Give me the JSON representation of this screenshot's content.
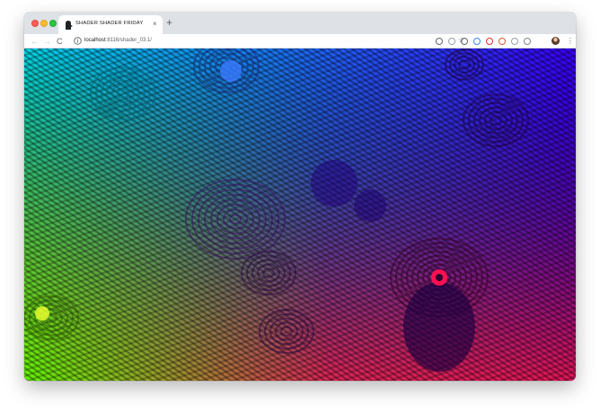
{
  "tab": {
    "title": "SHADER SHADER FRIDAY",
    "close_glyph": "×",
    "new_tab_glyph": "+"
  },
  "toolbar": {
    "back_glyph": "←",
    "forward_glyph": "→",
    "reload_glyph": "C",
    "url_host": "localhost",
    "url_rest": ":8116/shader_03.1/",
    "bookmark_glyph": "☆",
    "menu_glyph": "⋮"
  },
  "extensions": [
    {
      "icon": "info-extension-icon",
      "color": "#5f6368"
    },
    {
      "icon": "page-extension-icon",
      "color": "#9aa0a6"
    },
    {
      "icon": "recycle-extension-icon",
      "color": "#5f6368"
    },
    {
      "icon": "chrome-extension-icon",
      "color": "#4285f4"
    },
    {
      "icon": "opera-extension-icon",
      "color": "#e0352b"
    },
    {
      "icon": "duckduckgo-extension-icon",
      "color": "#de5833"
    },
    {
      "icon": "mail-extension-icon",
      "color": "#9aa0a6"
    },
    {
      "icon": "circle-extension-icon",
      "color": "#80868b"
    }
  ],
  "colors": {
    "chrome_frame": "#dee1e6",
    "shader_top_left": "#00d5e8",
    "shader_bottom_left": "#5cff00",
    "shader_top_right": "#3a00ff",
    "shader_bottom_right": "#ff1a3a"
  }
}
